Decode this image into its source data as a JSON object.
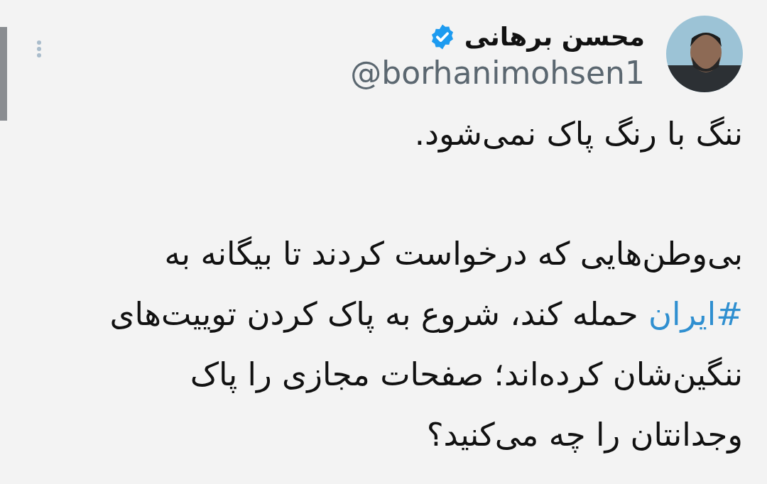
{
  "author": {
    "name": "محسن برهانی",
    "verified": true,
    "handle": "@borhanimohsen1"
  },
  "body": {
    "paragraphs": [
      [
        [
          {
            "kind": "text",
            "text": "ننگ با رنگ پاک نمی‌شود."
          }
        ]
      ],
      [
        [
          {
            "kind": "text",
            "text": "بی‌وطن‌هایی که درخواست کردند تا بیگانه به"
          }
        ],
        [
          {
            "kind": "hashtag",
            "text": "#ایران"
          },
          {
            "kind": "text",
            "text": " حمله کند، شروع به پاک کردن توییت‌های"
          }
        ],
        [
          {
            "kind": "text",
            "text": "ننگین‌شان کرده‌اند؛ صفحات مجازی را پاک"
          }
        ],
        [
          {
            "kind": "text",
            "text": "وجدانتان را چه می‌کنید؟"
          }
        ]
      ]
    ]
  }
}
